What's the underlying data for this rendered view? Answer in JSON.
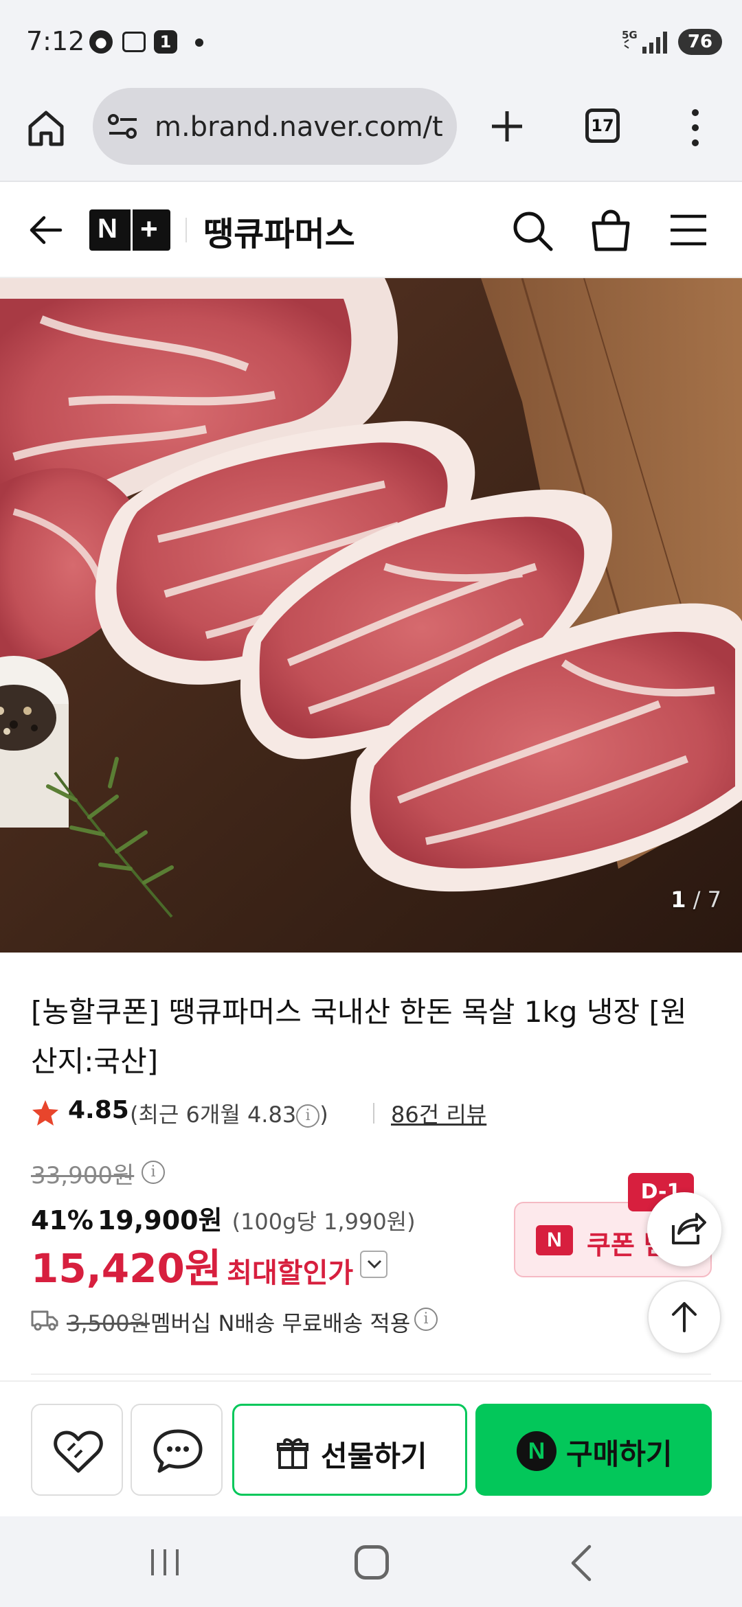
{
  "status_bar": {
    "time": "7:12",
    "notification_count": "1",
    "network": "5G",
    "battery": "76"
  },
  "browser": {
    "url": "m.brand.naver.com/t",
    "tab_count": "17"
  },
  "header": {
    "brand_name": "땡큐파머스",
    "logo_n": "N",
    "logo_plus": "+"
  },
  "gallery": {
    "current": "1",
    "separator": " / ",
    "total": "7"
  },
  "product": {
    "title": "[농할쿠폰] 땡큐파머스 국내산 한돈 목살 1kg 냉장 [원산지:국산]",
    "rating": "4.85",
    "recent_rating_text": "(최근 6개월 4.83",
    "recent_rating_close": ")",
    "review_count": "86건 리뷰",
    "original_price": "33,900원",
    "discount_rate": "41%",
    "discount_price": "19,900원",
    "unit_price": "(100g당 1,990원)",
    "max_discount_price": "15,420원",
    "max_discount_label": "최대할인가",
    "shipping_fee": "3,500원",
    "shipping_text": "멤버십 N배송 무료배송 적용"
  },
  "coupon": {
    "badge": "D-1",
    "n_mark": "N",
    "label": "쿠폰 받기"
  },
  "actions": {
    "gift_label": "선물하기",
    "buy_label": "구매하기",
    "buy_n": "N"
  },
  "icons": [
    "home-icon",
    "tune-icon",
    "plus-icon",
    "more-vert-icon",
    "back-arrow-icon",
    "search-icon",
    "bag-icon",
    "menu-icon",
    "star-icon",
    "info-icon",
    "chevron-down-icon",
    "truck-icon",
    "share-icon",
    "arrow-up-icon",
    "heart-icon",
    "chat-icon",
    "gift-icon"
  ],
  "colors": {
    "accent_red": "#d71f3e",
    "naver_green": "#03c75a",
    "chrome_bg": "#f2f3f6"
  }
}
